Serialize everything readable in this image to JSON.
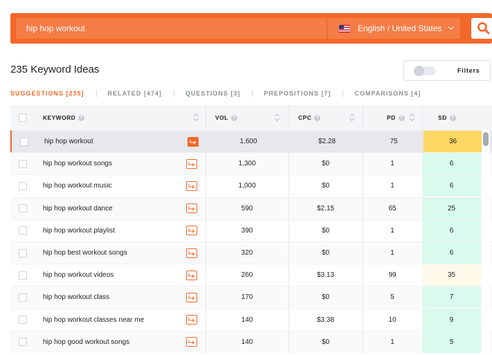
{
  "search": {
    "query": "hip hop workout",
    "language": "English / United States"
  },
  "results_title": "235 Keyword Ideas",
  "filters_label": "Filters",
  "tabs": [
    {
      "label": "SUGGESTIONS [235]",
      "active": true
    },
    {
      "label": "RELATED [474]",
      "active": false
    },
    {
      "label": "QUESTIONS [3]",
      "active": false
    },
    {
      "label": "PREPOSITIONS [7]",
      "active": false
    },
    {
      "label": "COMPARISONS [4]",
      "active": false
    }
  ],
  "columns": {
    "keyword": "KEYWORD",
    "vol": "VOL",
    "cpc": "CPC",
    "pd": "PD",
    "sd": "SD"
  },
  "rows": [
    {
      "keyword": "hip hop workout",
      "vol": "1,600",
      "cpc": "$2.28",
      "pd": "75",
      "sd": "36",
      "sd_color": "#fdd663",
      "selected": true
    },
    {
      "keyword": "hip hop workout songs",
      "vol": "1,300",
      "cpc": "$0",
      "pd": "1",
      "sd": "6",
      "sd_color": "#d9fbee",
      "selected": false
    },
    {
      "keyword": "hip hop workout music",
      "vol": "1,000",
      "cpc": "$0",
      "pd": "1",
      "sd": "6",
      "sd_color": "#d9fbee",
      "selected": false
    },
    {
      "keyword": "hip hop workout dance",
      "vol": "590",
      "cpc": "$2.15",
      "pd": "65",
      "sd": "25",
      "sd_color": "#d9fbee",
      "selected": false
    },
    {
      "keyword": "hip hop workout playlist",
      "vol": "390",
      "cpc": "$0",
      "pd": "1",
      "sd": "6",
      "sd_color": "#d9fbee",
      "selected": false
    },
    {
      "keyword": "hip hop best workout songs",
      "vol": "320",
      "cpc": "$0",
      "pd": "1",
      "sd": "6",
      "sd_color": "#d9fbee",
      "selected": false
    },
    {
      "keyword": "hip hop workout videos",
      "vol": "260",
      "cpc": "$3.13",
      "pd": "99",
      "sd": "35",
      "sd_color": "#fffaea",
      "selected": false
    },
    {
      "keyword": "hip hop workout class",
      "vol": "170",
      "cpc": "$0",
      "pd": "5",
      "sd": "7",
      "sd_color": "#d9fbee",
      "selected": false
    },
    {
      "keyword": "hip hop workout classes near me",
      "vol": "140",
      "cpc": "$3.38",
      "pd": "10",
      "sd": "9",
      "sd_color": "#d9fbee",
      "selected": false
    },
    {
      "keyword": "hip hop good workout songs",
      "vol": "140",
      "cpc": "$0",
      "pd": "1",
      "sd": "5",
      "sd_color": "#d9fbee",
      "selected": false
    }
  ],
  "colors": {
    "accent": "#f2682a"
  }
}
